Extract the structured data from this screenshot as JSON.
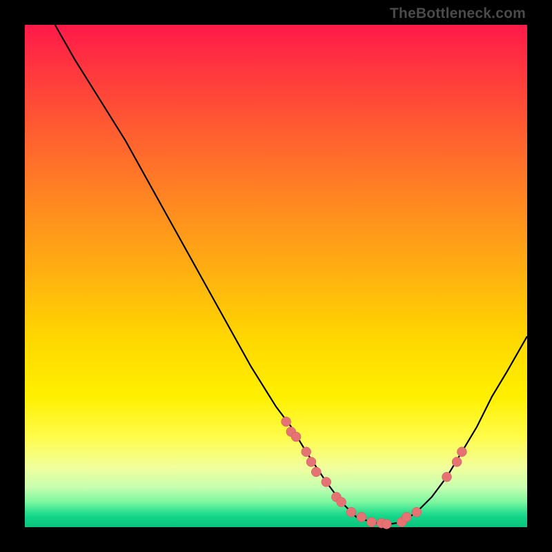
{
  "attribution": "TheBottleneck.com",
  "colors": {
    "background": "#000000",
    "curve": "#000000",
    "marker_fill": "#e57373",
    "marker_stroke": "#c85a5a"
  },
  "chart_data": {
    "type": "line",
    "title": "",
    "xlabel": "",
    "ylabel": "",
    "xlim": [
      0,
      100
    ],
    "ylim": [
      0,
      100
    ],
    "note": "Bottleneck-style V curve; y is bottleneck % (0 = ideal at trough), x is relative component strength. Values estimated from pixel positions.",
    "curve": [
      {
        "x": 6,
        "y": 100
      },
      {
        "x": 10,
        "y": 93
      },
      {
        "x": 15,
        "y": 85
      },
      {
        "x": 20,
        "y": 77
      },
      {
        "x": 25,
        "y": 68
      },
      {
        "x": 30,
        "y": 59
      },
      {
        "x": 35,
        "y": 50
      },
      {
        "x": 40,
        "y": 41
      },
      {
        "x": 45,
        "y": 32
      },
      {
        "x": 50,
        "y": 24
      },
      {
        "x": 53,
        "y": 20
      },
      {
        "x": 56,
        "y": 15
      },
      {
        "x": 58,
        "y": 12
      },
      {
        "x": 60,
        "y": 9
      },
      {
        "x": 63,
        "y": 5
      },
      {
        "x": 66,
        "y": 2
      },
      {
        "x": 69,
        "y": 1
      },
      {
        "x": 72,
        "y": 0.5
      },
      {
        "x": 75,
        "y": 1
      },
      {
        "x": 78,
        "y": 3
      },
      {
        "x": 81,
        "y": 6
      },
      {
        "x": 84,
        "y": 10
      },
      {
        "x": 87,
        "y": 15
      },
      {
        "x": 90,
        "y": 20
      },
      {
        "x": 93,
        "y": 26
      },
      {
        "x": 96,
        "y": 31
      },
      {
        "x": 100,
        "y": 38
      }
    ],
    "markers": [
      {
        "x": 52,
        "y": 21
      },
      {
        "x": 53,
        "y": 19
      },
      {
        "x": 54,
        "y": 18
      },
      {
        "x": 56,
        "y": 15
      },
      {
        "x": 57,
        "y": 13
      },
      {
        "x": 58,
        "y": 11
      },
      {
        "x": 60,
        "y": 9
      },
      {
        "x": 62,
        "y": 6
      },
      {
        "x": 63,
        "y": 5
      },
      {
        "x": 65,
        "y": 3
      },
      {
        "x": 67,
        "y": 2
      },
      {
        "x": 69,
        "y": 1
      },
      {
        "x": 71,
        "y": 0.8
      },
      {
        "x": 72,
        "y": 0.6
      },
      {
        "x": 75,
        "y": 1
      },
      {
        "x": 76,
        "y": 2
      },
      {
        "x": 78,
        "y": 3
      },
      {
        "x": 84,
        "y": 10
      },
      {
        "x": 86,
        "y": 13
      },
      {
        "x": 87,
        "y": 15
      }
    ]
  }
}
